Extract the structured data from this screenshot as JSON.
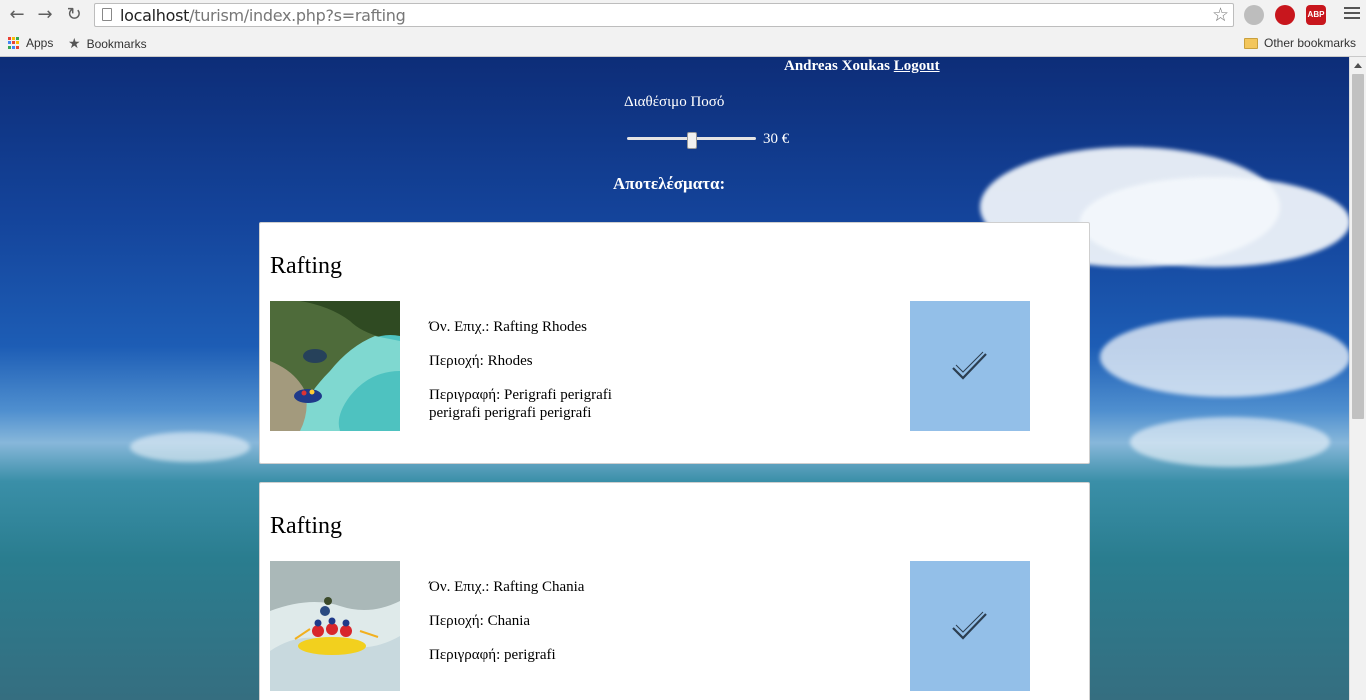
{
  "browser": {
    "url_host": "localhost",
    "url_rest": "/turism/index.php?s=rafting",
    "bookmarks": {
      "apps": "Apps",
      "bookmarks": "Bookmarks",
      "other": "Other bookmarks"
    },
    "extensions": {
      "abp": "ABP"
    }
  },
  "header": {
    "user_name": "Andreas Xoukas",
    "logout": "Logout"
  },
  "budget": {
    "label": "Διαθέσιμο Ποσό",
    "value": "30 €",
    "slider_fraction": 0.5
  },
  "results": {
    "title": "Αποτελέσματα:",
    "items": [
      {
        "category": "Rafting",
        "company": "Όν. Επιχ.: Rafting Rhodes",
        "area": "Περιοχή: Rhodes",
        "description": "Περιγραφή: Perigrafi perigrafi perigrafi perigrafi perigrafi",
        "photo": "river-rafting-photo"
      },
      {
        "category": "Rafting",
        "company": "Όν. Επιχ.: Rafting Chania",
        "area": "Περιοχή: Chania",
        "description": "Περιγραφή: perigrafi",
        "photo": "whitewater-rafting-photo"
      }
    ]
  },
  "colors": {
    "select_button": "#93bfe8",
    "sky": "#14449b",
    "sea": "#2a7d8f"
  },
  "icons": {
    "select": "checkmark-icon"
  }
}
